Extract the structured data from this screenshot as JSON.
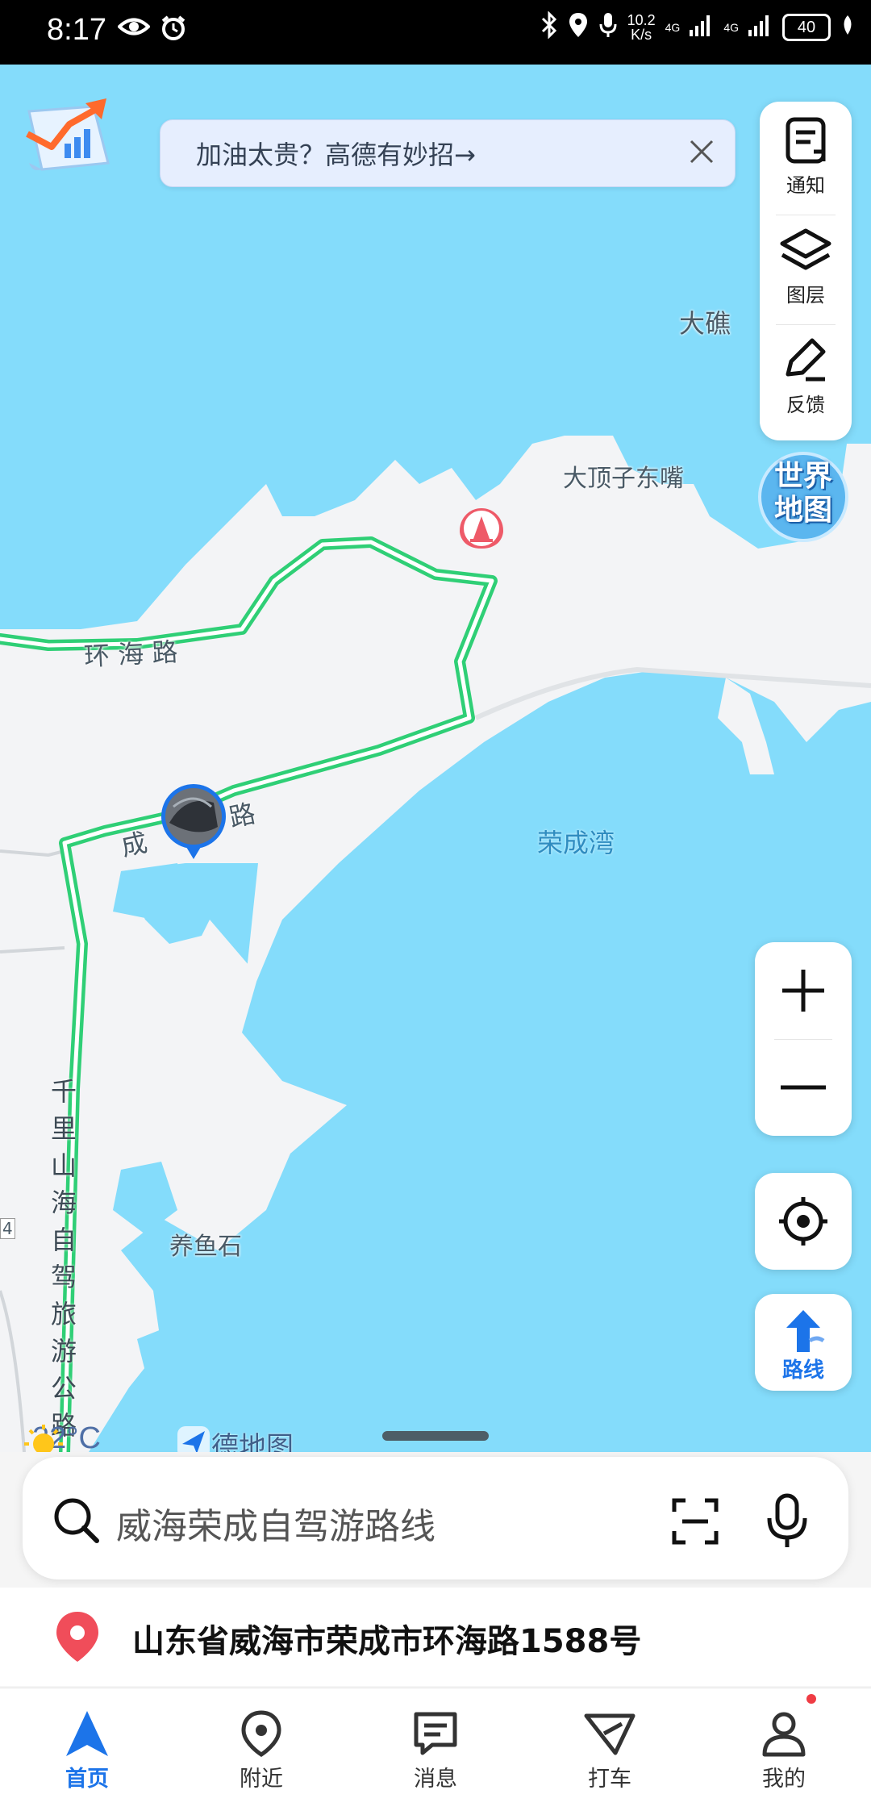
{
  "status_bar": {
    "time": "8:17",
    "net_speed_value": "10.2",
    "net_speed_unit": "K/s",
    "signal_1": "4G",
    "signal_2": "4G",
    "battery": "40"
  },
  "banner": {
    "text": "加油太贵？高德有妙招→"
  },
  "tools": {
    "notice": "通知",
    "layers": "图层",
    "feedback": "反馈"
  },
  "world_map_badge": "世界地图",
  "map_labels": {
    "dajiao": "大礁",
    "dadingzi": "大顶子东嘴",
    "huanhai_road": "环 海 路",
    "cheng_road": "成",
    "cheng_road_suffix": "路",
    "rongcheng_bay": "荣成湾",
    "yangyushi": "养鱼石",
    "vertical_road": "千里山海自驾旅游公路",
    "edge_marker": "4"
  },
  "weather": {
    "temperature": "22°C",
    "icon": "sun-icon"
  },
  "brand": {
    "logo_text": "高德地图"
  },
  "zoom": {
    "in_icon": "plus-icon",
    "out_icon": "minus-icon"
  },
  "route_button": {
    "label": "路线"
  },
  "search": {
    "placeholder": "威海荣成自驾游路线"
  },
  "location": {
    "address": "山东省威海市荣成市环海路1588号"
  },
  "tabs": [
    {
      "label": "首页",
      "icon": "navigation-arrow-icon",
      "active": true
    },
    {
      "label": "附近",
      "icon": "location-pin-icon",
      "active": false
    },
    {
      "label": "消息",
      "icon": "message-icon",
      "active": false
    },
    {
      "label": "打车",
      "icon": "taxi-icon",
      "active": false
    },
    {
      "label": "我的",
      "icon": "profile-icon",
      "active": false
    }
  ],
  "colors": {
    "water": "#84dcfb",
    "land": "#f3f4f6",
    "road_green": "#2fcf76",
    "accent_blue": "#1c74e9"
  }
}
